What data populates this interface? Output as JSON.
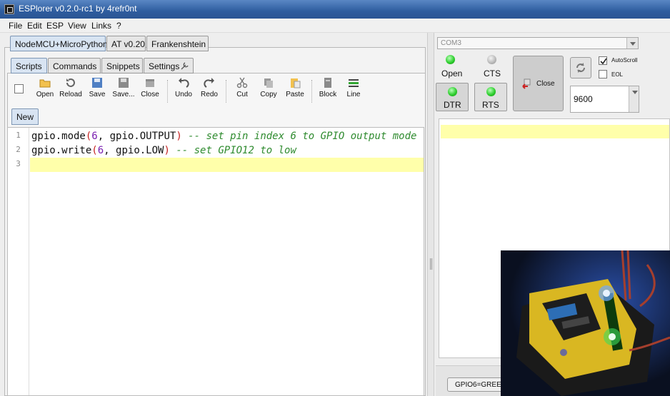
{
  "window": {
    "title": "ESPlorer v0.2.0-rc1 by 4refr0nt"
  },
  "menu": [
    "File",
    "Edit",
    "ESP",
    "View",
    "Links",
    "?"
  ],
  "firmware_tabs": [
    "NodeMCU+MicroPython",
    "AT v0.20",
    "Frankenshtein"
  ],
  "sub_tabs": [
    "Scripts",
    "Commands",
    "Snippets",
    "Settings"
  ],
  "toolbar": {
    "open": "Open",
    "reload": "Reload",
    "save": "Save",
    "save_as": "Save...",
    "close": "Close",
    "undo": "Undo",
    "redo": "Redo",
    "cut": "Cut",
    "copy": "Copy",
    "paste": "Paste",
    "block": "Block",
    "line": "Line"
  },
  "file_tab": "New",
  "editor": {
    "line_numbers": [
      "1",
      "2",
      "3"
    ],
    "lines": [
      {
        "a": "gpio.mode",
        "b": "(",
        "c": "6",
        "d": ", gpio.OUTPUT",
        "e": ")",
        "f": " -- set pin index 6 to GPIO output mode"
      },
      {
        "a": "gpio.write",
        "b": "(",
        "c": "6",
        "d": ", gpio.LOW",
        "e": ")",
        "f": " -- set GPIO12 to low"
      }
    ]
  },
  "serial": {
    "port": "COM3",
    "open_label": "Open",
    "cts_label": "CTS",
    "dtr_label": "DTR",
    "rts_label": "RTS",
    "close_label": "Close",
    "autoscroll_label": "AutoScroll",
    "autoscroll_checked": true,
    "eol_label": "EOL",
    "eol_checked": false,
    "baud": "9600"
  },
  "snippet_button": "GPIO6=GREEN",
  "colors": {
    "title_bar": "#2e5d9f",
    "current_line": "#ffffaa",
    "led_on": "#2fcf2f",
    "led_off": "#bcbcbc"
  }
}
